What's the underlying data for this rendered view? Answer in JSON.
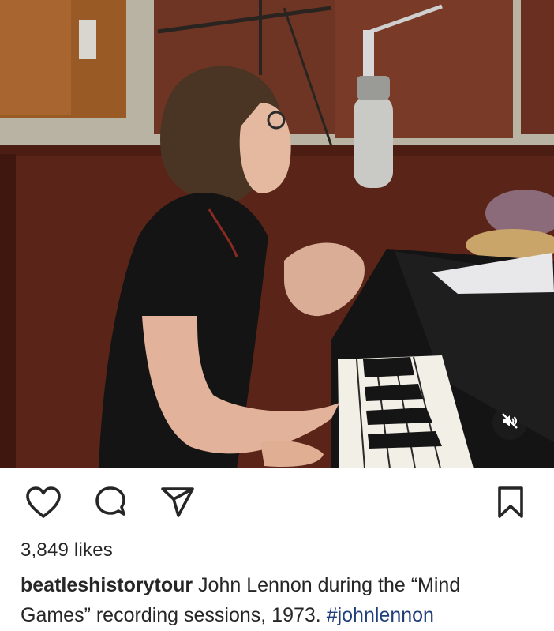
{
  "post": {
    "media": {
      "mute_icon": "speaker-muted-icon"
    },
    "actions": {
      "like_icon": "heart-icon",
      "comment_icon": "comment-bubble-icon",
      "share_icon": "paper-plane-icon",
      "save_icon": "bookmark-icon"
    },
    "likes_text": "3,849 likes",
    "caption": {
      "username": "beatleshistorytour",
      "text": " John Lennon during the “Mind Games” recording sessions, 1973. ",
      "hashtag": "#johnlennon"
    }
  },
  "colors": {
    "text": "#262626",
    "hashtag": "#1f3f7a",
    "mute_badge": "#1e1e1e"
  }
}
